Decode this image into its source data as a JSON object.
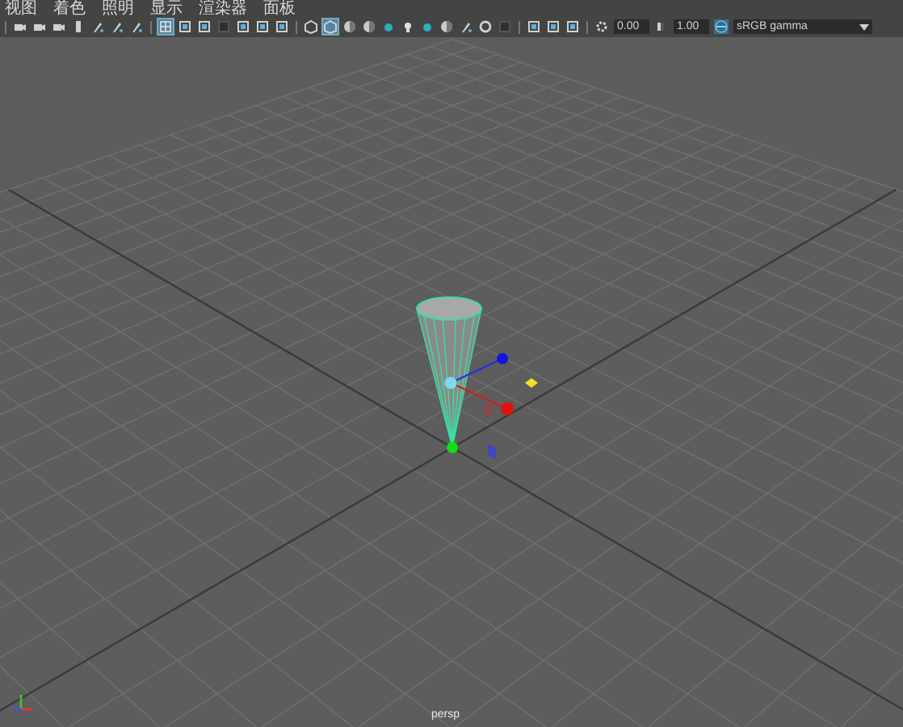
{
  "menu": [
    {
      "label": "视图"
    },
    {
      "label": "着色"
    },
    {
      "label": "照明"
    },
    {
      "label": "显示"
    },
    {
      "label": "渲染器"
    },
    {
      "label": "面板"
    }
  ],
  "toolbar": {
    "groups": [
      [
        {
          "kind": "camera",
          "selected": false
        },
        {
          "kind": "camera",
          "selected": false
        },
        {
          "kind": "camera",
          "selected": false
        },
        {
          "kind": "bar",
          "selected": false
        },
        {
          "kind": "brush",
          "selected": false
        },
        {
          "kind": "brush",
          "selected": false
        },
        {
          "kind": "brush",
          "selected": false
        }
      ],
      [
        {
          "kind": "grid",
          "selected": true
        },
        {
          "kind": "frame",
          "selected": false
        },
        {
          "kind": "frame",
          "selected": false
        },
        {
          "kind": "square",
          "selected": false
        },
        {
          "kind": "frame",
          "selected": false
        },
        {
          "kind": "frame",
          "selected": false
        },
        {
          "kind": "frame",
          "selected": false
        }
      ],
      [
        {
          "kind": "cube",
          "selected": false
        },
        {
          "kind": "cube",
          "selected": true
        },
        {
          "kind": "sphere",
          "selected": false
        },
        {
          "kind": "sphere",
          "selected": false
        },
        {
          "kind": "dot",
          "selected": false
        },
        {
          "kind": "light",
          "selected": false
        },
        {
          "kind": "dot",
          "selected": false
        },
        {
          "kind": "sphere",
          "selected": false
        },
        {
          "kind": "brush",
          "selected": false
        },
        {
          "kind": "circle",
          "selected": false
        },
        {
          "kind": "square",
          "selected": false
        }
      ],
      [
        {
          "kind": "frame",
          "selected": false
        },
        {
          "kind": "frame",
          "selected": false
        },
        {
          "kind": "frame",
          "selected": false
        }
      ]
    ],
    "exposure": "0.00",
    "gamma": "1.00",
    "view_transform_on": true,
    "view_transform": "sRGB gamma"
  },
  "viewport": {
    "camera": "persp"
  }
}
